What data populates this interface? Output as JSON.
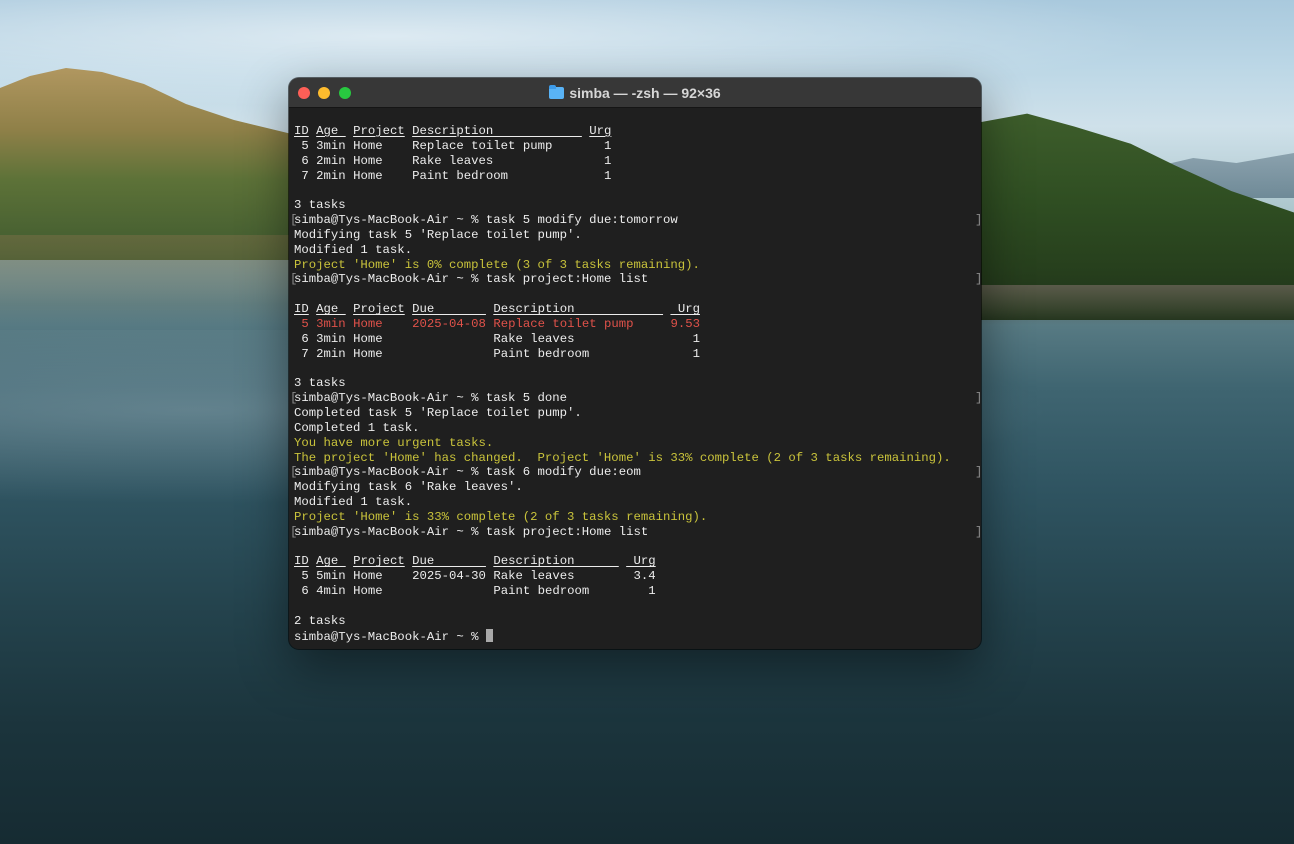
{
  "window": {
    "title": "simba — -zsh — 92×36"
  },
  "terminal": {
    "prompt": "simba@Tys-MacBook-Air ~ % ",
    "table1": {
      "headers": [
        "ID",
        "Age",
        "Project",
        "Description",
        "Urg"
      ],
      "rows": [
        [
          "5",
          "3min",
          "Home",
          "Replace toilet pump",
          "1"
        ],
        [
          "6",
          "2min",
          "Home",
          "Rake leaves",
          "1"
        ],
        [
          "7",
          "2min",
          "Home",
          "Paint bedroom",
          "1"
        ]
      ],
      "count": "3 tasks"
    },
    "cmd1": "task 5 modify due:tomorrow",
    "cmd1_out": [
      "Modifying task 5 'Replace toilet pump'.",
      "Modified 1 task."
    ],
    "cmd1_info": "Project 'Home' is 0% complete (3 of 3 tasks remaining).",
    "cmd2": "task project:Home list",
    "table2": {
      "headers": [
        "ID",
        "Age",
        "Project",
        "Due",
        "Description",
        "Urg"
      ],
      "rows": [
        [
          "5",
          "3min",
          "Home",
          "2025-04-08",
          "Replace toilet pump",
          "9.53"
        ],
        [
          "6",
          "3min",
          "Home",
          "",
          "Rake leaves",
          "1"
        ],
        [
          "7",
          "2min",
          "Home",
          "",
          "Paint bedroom",
          "1"
        ]
      ],
      "count": "3 tasks"
    },
    "cmd3": "task 5 done",
    "cmd3_out": [
      "Completed task 5 'Replace toilet pump'.",
      "Completed 1 task."
    ],
    "cmd3_info": [
      "You have more urgent tasks.",
      "The project 'Home' has changed.  Project 'Home' is 33% complete (2 of 3 tasks remaining)."
    ],
    "cmd4": "task 6 modify due:eom",
    "cmd4_out": [
      "Modifying task 6 'Rake leaves'.",
      "Modified 1 task."
    ],
    "cmd4_info": "Project 'Home' is 33% complete (2 of 3 tasks remaining).",
    "cmd5": "task project:Home list",
    "table3": {
      "headers": [
        "ID",
        "Age",
        "Project",
        "Due",
        "Description",
        "Urg"
      ],
      "rows": [
        [
          "5",
          "5min",
          "Home",
          "2025-04-30",
          "Rake leaves",
          "3.4"
        ],
        [
          "6",
          "4min",
          "Home",
          "",
          "Paint bedroom",
          "1"
        ]
      ],
      "count": "2 tasks"
    },
    "colors": {
      "info": "#c9c33b",
      "overdue": "#e0524a"
    }
  }
}
